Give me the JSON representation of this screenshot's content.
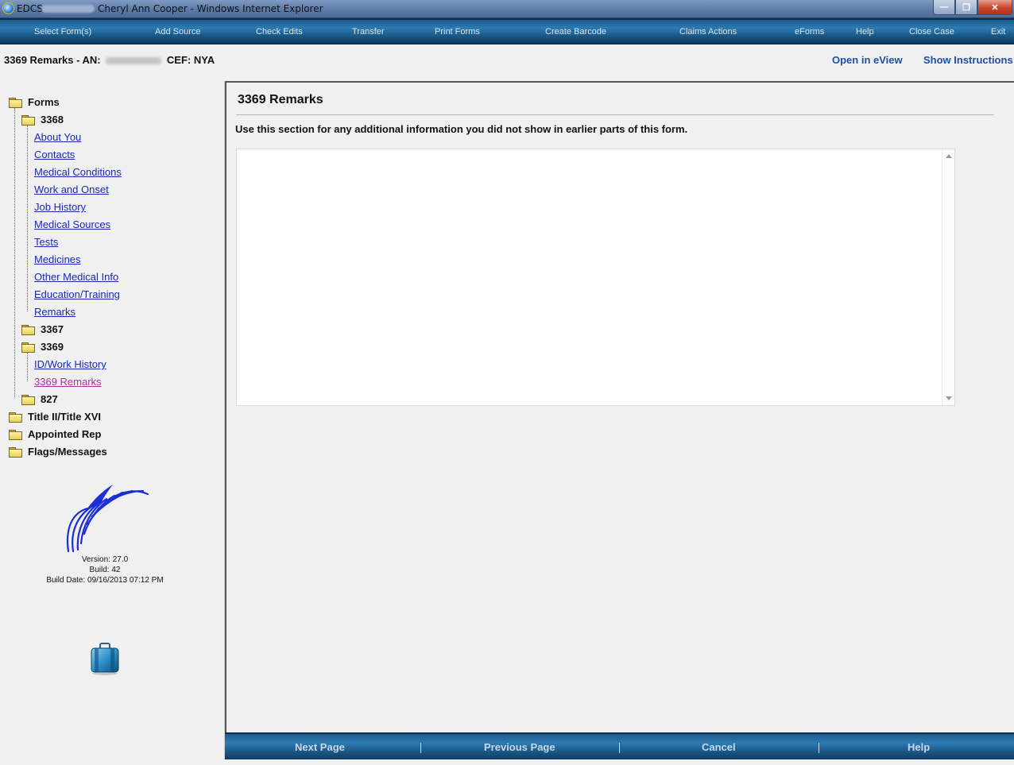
{
  "window": {
    "title_prefix": "EDCS",
    "title_suffix": "Cheryl Ann Cooper - Windows Internet Explorer",
    "min_glyph": "—",
    "max_glyph": "❐",
    "close_glyph": "✕"
  },
  "menu": [
    "Select Form(s)",
    "Add Source",
    "Check Edits",
    "Transfer",
    "Print Forms",
    "Create Barcode",
    "Claims Actions",
    "eForms",
    "Help",
    "Close Case",
    "Exit"
  ],
  "header": {
    "title_left": "3369 Remarks - AN:",
    "title_right": "CEF: NYA",
    "open_eview": "Open in eView",
    "show_instructions": "Show Instructions"
  },
  "tree": {
    "forms_label": "Forms",
    "folder_3368": "3368",
    "links_3368": [
      "About You",
      "Contacts",
      "Medical Conditions",
      "Work and Onset",
      "Job History",
      "Medical Sources",
      "Tests",
      "Medicines",
      "Other Medical Info",
      "Education/Training",
      "Remarks"
    ],
    "folder_3367": "3367",
    "folder_3369": "3369",
    "links_3369": [
      "ID/Work History",
      "3369 Remarks"
    ],
    "folder_827": "827",
    "title_ii": "Title II/Title XVI",
    "appointed_rep": "Appointed Rep",
    "flags_messages": "Flags/Messages"
  },
  "version": {
    "version": "Version: 27.0",
    "build": "Build: 42",
    "build_date": "Build Date: 09/16/2013 07:12 PM"
  },
  "main": {
    "title": "3369 Remarks",
    "instructions": "Use this section for any additional information you did not show in earlier parts of this form.",
    "remarks_value": ""
  },
  "bottom": {
    "next": "Next Page",
    "previous": "Previous Page",
    "cancel": "Cancel",
    "help": "Help"
  },
  "colors": {
    "menu_bar": "#1a5683",
    "link": "#1a2bb0",
    "active_link": "#b0309f",
    "header_link": "#1f4fa8"
  }
}
